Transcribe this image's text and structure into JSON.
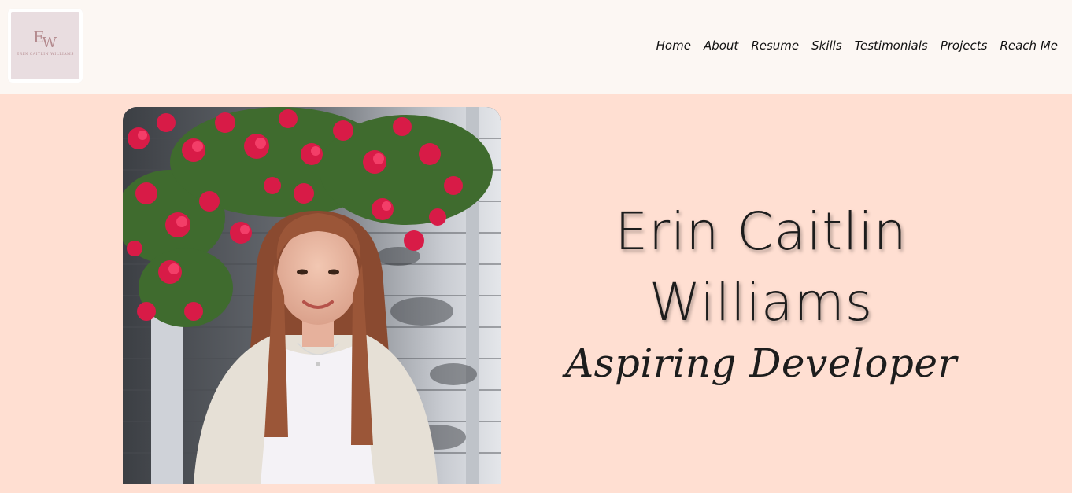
{
  "logo": {
    "monogram_e": "E",
    "monogram_w": "W",
    "name": "ERIN CAITLIN WILLIAMS"
  },
  "nav": {
    "items": [
      "Home",
      "About",
      "Resume",
      "Skills",
      "Testimonials",
      "Projects",
      "Reach Me"
    ]
  },
  "hero": {
    "name_line1": "Erin Caitlin",
    "name_line2": "Williams",
    "role": "Aspiring Developer"
  },
  "colors": {
    "header_bg": "#fcf7f3",
    "hero_bg": "#ffdfd2",
    "text": "#1d1d1d",
    "logo_accent": "#b48a8e"
  }
}
